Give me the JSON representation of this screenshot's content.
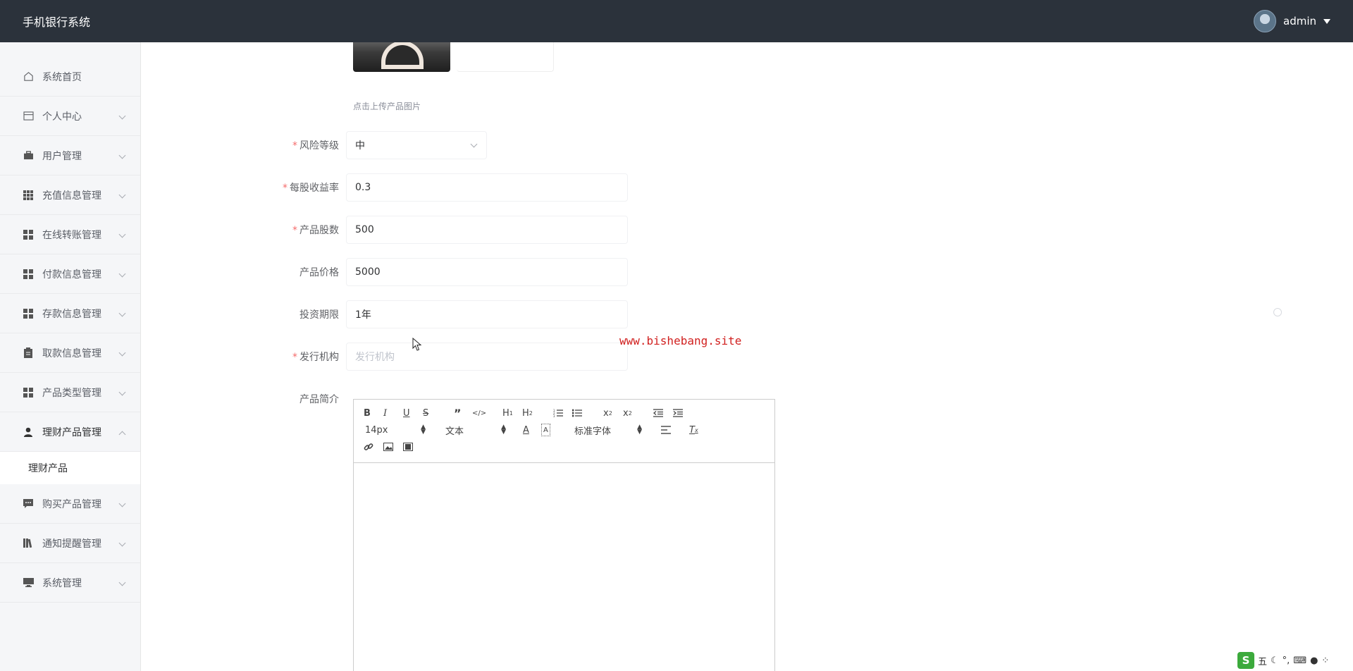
{
  "header": {
    "app_title": "手机银行系统",
    "username": "admin"
  },
  "sidebar": {
    "items": [
      {
        "label": "系统首页",
        "icon": "home-icon"
      },
      {
        "label": "个人中心",
        "icon": "card-icon"
      },
      {
        "label": "用户管理",
        "icon": "briefcase-icon"
      },
      {
        "label": "充值信息管理",
        "icon": "grid-icon"
      },
      {
        "label": "在线转账管理",
        "icon": "apps-icon"
      },
      {
        "label": "付款信息管理",
        "icon": "apps-icon"
      },
      {
        "label": "存款信息管理",
        "icon": "apps-icon"
      },
      {
        "label": "取款信息管理",
        "icon": "clipboard-icon"
      },
      {
        "label": "产品类型管理",
        "icon": "apps-icon"
      },
      {
        "label": "理财产品管理",
        "icon": "user-icon",
        "expanded": true
      },
      {
        "label": "购买产品管理",
        "icon": "chat-icon"
      },
      {
        "label": "通知提醒管理",
        "icon": "library-icon"
      },
      {
        "label": "系统管理",
        "icon": "monitor-icon"
      }
    ],
    "sub_item": "理财产品"
  },
  "form": {
    "upload_tip": "点击上传产品图片",
    "risk": {
      "label": "风险等级",
      "value": "中"
    },
    "yield": {
      "label": "每股收益率",
      "value": "0.3"
    },
    "shares": {
      "label": "产品股数",
      "value": "500"
    },
    "price": {
      "label": "产品价格",
      "value": "5000"
    },
    "term": {
      "label": "投资期限",
      "value": "1年"
    },
    "issuer": {
      "label": "发行机构",
      "placeholder": "发行机构"
    },
    "intro": {
      "label": "产品简介"
    }
  },
  "editor": {
    "font_size": "14px",
    "text_type": "文本",
    "font_family": "标准字体"
  },
  "watermark": "www.bishebang.site",
  "ime": {
    "mode": "五"
  },
  "colors": {
    "header_bg": "#2b323b",
    "required": "#f56c6c",
    "watermark": "#d1201f"
  }
}
